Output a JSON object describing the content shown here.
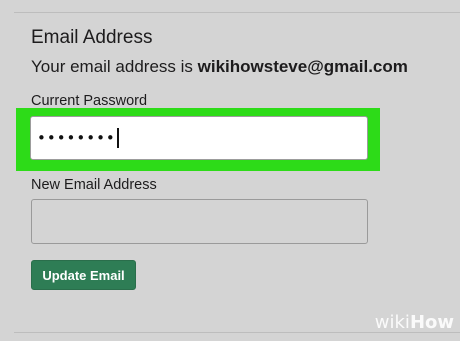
{
  "section": {
    "title": "Email Address",
    "email_prefix": "Your email address is ",
    "email_value": "wikihowsteve@gmail.com"
  },
  "current_password": {
    "label": "Current Password",
    "value": "••••••••"
  },
  "new_email": {
    "label": "New Email Address",
    "value": ""
  },
  "buttons": {
    "update_label": "Update Email"
  },
  "watermark": {
    "wiki": "wiki",
    "how": "How"
  },
  "colors": {
    "highlight": "#2ddb18",
    "button": "#2e7d55",
    "background": "#d4d4d4"
  }
}
